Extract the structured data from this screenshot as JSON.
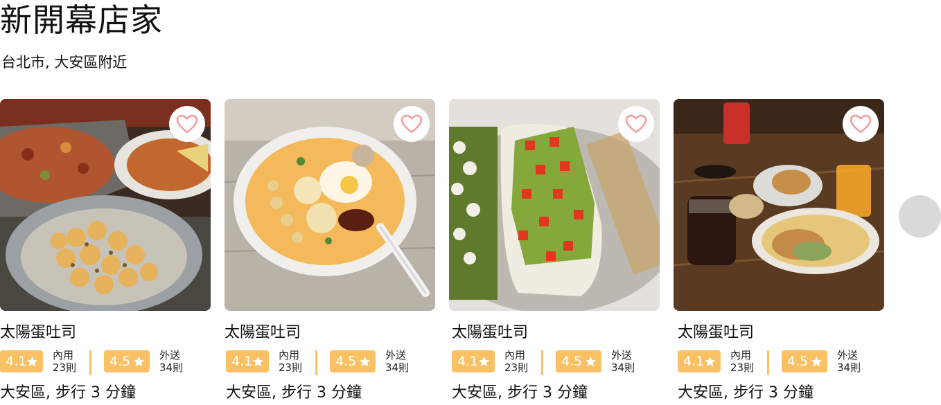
{
  "header": {
    "title": "新開幕店家",
    "subtitle": "台北市, 大安區附近"
  },
  "colors": {
    "rating_badge": "#f9c163",
    "heart": "#f19a9a",
    "next_button": "#d9d9d9"
  },
  "cards": [
    {
      "name": "太陽蛋吐司",
      "dine_in_rating": "4.1",
      "dine_in_label": "內用",
      "dine_in_count": "23則",
      "delivery_rating": "4.5",
      "delivery_label": "外送",
      "delivery_count": "34則",
      "location": "大安區,  步行 3 分鐘",
      "image": "pasta-and-flatbread-photo",
      "favorite_icon": "heart-icon"
    },
    {
      "name": "太陽蛋吐司",
      "dine_in_rating": "4.1",
      "dine_in_label": "內用",
      "dine_in_count": "23則",
      "delivery_rating": "4.5",
      "delivery_label": "外送",
      "delivery_count": "34則",
      "location": "大安區,  步行 3 分鐘",
      "image": "noodle-soup-bowl-photo",
      "favorite_icon": "heart-icon"
    },
    {
      "name": "太陽蛋吐司",
      "dine_in_rating": "4.1",
      "dine_in_label": "內用",
      "dine_in_count": "23則",
      "delivery_rating": "4.5",
      "delivery_label": "外送",
      "delivery_count": "34則",
      "location": "大安區,  步行 3 分鐘",
      "image": "avocado-toast-photo",
      "favorite_icon": "heart-icon"
    },
    {
      "name": "太陽蛋吐司",
      "dine_in_rating": "4.1",
      "dine_in_label": "內用",
      "dine_in_count": "23則",
      "delivery_rating": "4.5",
      "delivery_label": "外送",
      "delivery_count": "34則",
      "location": "大安區,  步行 3 分鐘",
      "image": "brunch-table-photo",
      "favorite_icon": "heart-icon"
    }
  ],
  "carousel": {
    "next_icon": "next-arrow-button"
  }
}
